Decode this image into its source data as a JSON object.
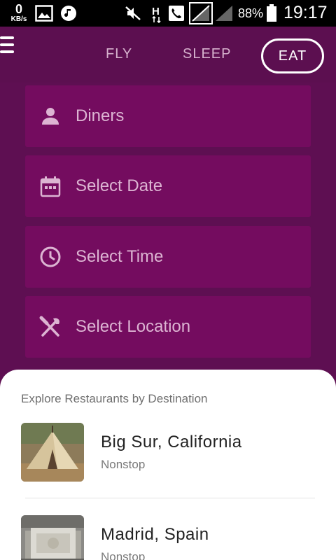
{
  "status_bar": {
    "net_speed_value": "0",
    "net_speed_unit": "KB/s",
    "battery_percent": "88%",
    "time": "19:17",
    "icons": [
      "gallery-icon",
      "music-icon",
      "mute-icon",
      "h-signal-icon",
      "call-icon",
      "sim1-signal-icon",
      "sim2-signal-icon",
      "battery-icon"
    ]
  },
  "tabs": {
    "fly": "FLY",
    "sleep": "SLEEP",
    "eat": "EAT",
    "active": "EAT"
  },
  "form": {
    "diners": "Diners",
    "date": "Select Date",
    "time": "Select Time",
    "location": "Select Location"
  },
  "explore": {
    "heading": "Explore Restaurants by Destination",
    "items": [
      {
        "name": "Big Sur, California",
        "subtitle": "Nonstop"
      },
      {
        "name": "Madrid, Spain",
        "subtitle": "Nonstop"
      }
    ]
  },
  "colors": {
    "background": "#5e0f52",
    "field": "#740c5f",
    "field_text": "#dcb4d2",
    "active_tab_border": "#ffffff"
  }
}
